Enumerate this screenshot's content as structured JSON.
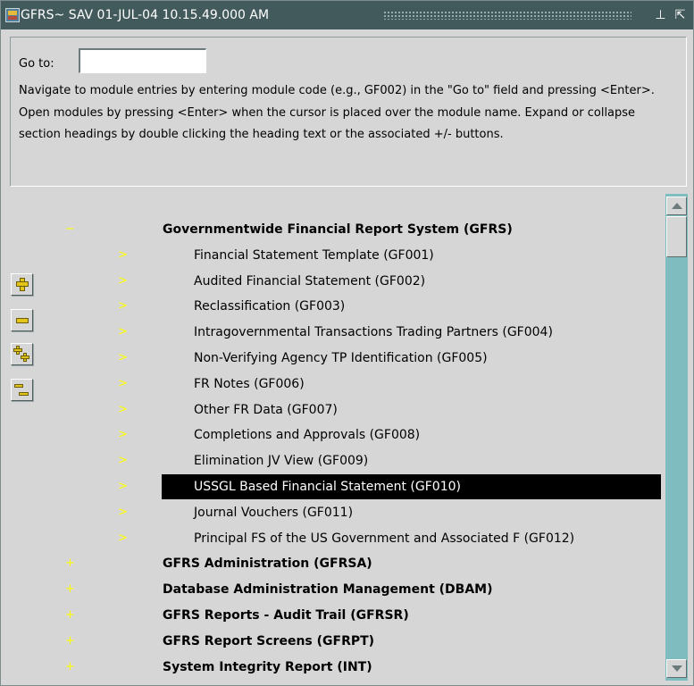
{
  "window": {
    "title": "GFRS~ SAV  01-JUL-04 10.15.49.000 AM",
    "minimize_glyph": "⊥",
    "maximize_glyph": "⇱"
  },
  "goto": {
    "label": "Go to:",
    "value": ""
  },
  "help_text": "Navigate to module entries by entering module code (e.g., GF002) in the \"Go to\" field and pressing <Enter>.  Open modules by pressing <Enter> when the cursor is placed over the module name.  Expand or collapse section headings by double clicking the heading text or the associated +/- buttons.",
  "side_buttons": [
    {
      "name": "expand",
      "icon": "plus-icon"
    },
    {
      "name": "collapse",
      "icon": "minus-icon"
    },
    {
      "name": "expand-all",
      "icon": "expand-all-icon"
    },
    {
      "name": "collapse-all",
      "icon": "collapse-all-icon"
    }
  ],
  "tree": [
    {
      "marker": "−",
      "label": "Governmentwide Financial Report System  (GFRS)",
      "heading": true
    },
    {
      "marker": ">",
      "label": "Financial Statement Template  (GF001)"
    },
    {
      "marker": ">",
      "label": "Audited Financial Statement  (GF002)"
    },
    {
      "marker": ">",
      "label": "Reclassification  (GF003)"
    },
    {
      "marker": ">",
      "label": "Intragovernmental Transactions Trading Partners  (GF004)"
    },
    {
      "marker": ">",
      "label": "Non-Verifying Agency TP Identification  (GF005)"
    },
    {
      "marker": ">",
      "label": "FR Notes  (GF006)"
    },
    {
      "marker": ">",
      "label": "Other FR Data  (GF007)"
    },
    {
      "marker": ">",
      "label": "Completions and Approvals  (GF008)"
    },
    {
      "marker": ">",
      "label": "Elimination JV View  (GF009)"
    },
    {
      "marker": ">",
      "label": "USSGL Based Financial Statement  (GF010)",
      "selected": true
    },
    {
      "marker": ">",
      "label": "Journal Vouchers  (GF011)"
    },
    {
      "marker": ">",
      "label": "Principal FS of the US Government and Associated F  (GF012)"
    },
    {
      "marker": "+",
      "label": "GFRS Administration  (GFRSA)",
      "heading": true
    },
    {
      "marker": "+",
      "label": "Database Administration Management  (DBAM)",
      "heading": true
    },
    {
      "marker": "+",
      "label": "GFRS Reports - Audit Trail  (GFRSR)",
      "heading": true
    },
    {
      "marker": "+",
      "label": "GFRS Report Screens  (GFRPT)",
      "heading": true
    },
    {
      "marker": "+",
      "label": "System Integrity Report  (INT)",
      "heading": true
    }
  ],
  "colors": {
    "titlebar": "#425a5b",
    "panel": "#d6d6d6",
    "scrollbar": "#7fbcc0",
    "marker": "#ffff00",
    "selection": "#000000"
  }
}
